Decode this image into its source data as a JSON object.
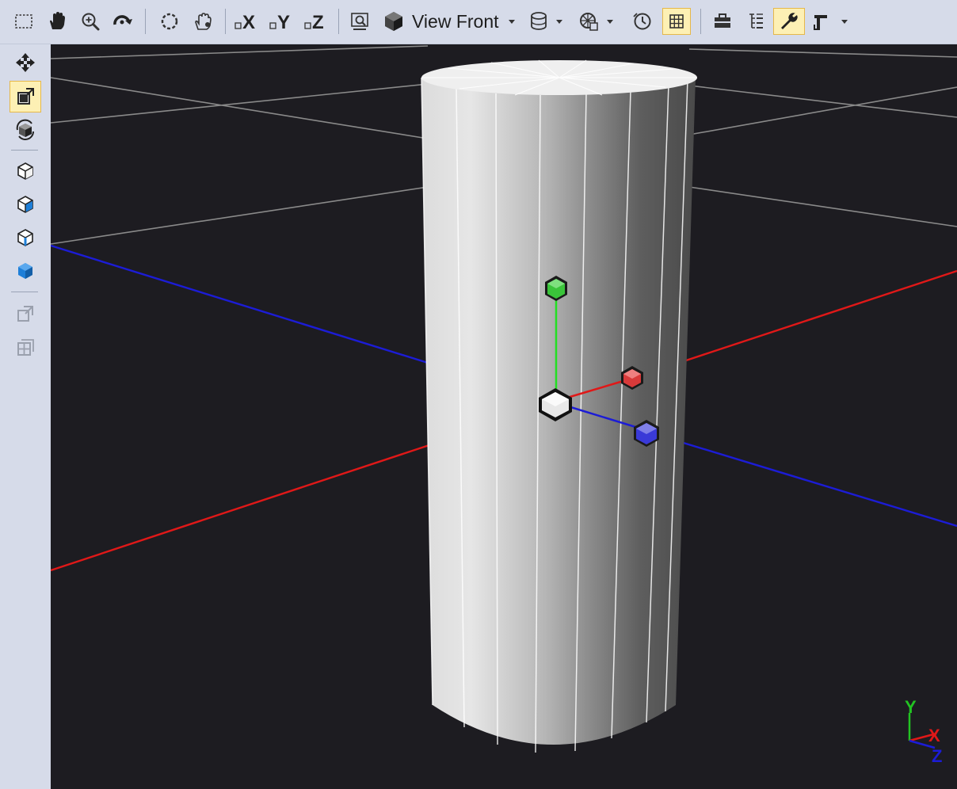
{
  "toolbar": {
    "items": [
      {
        "icon": "select-rect-icon"
      },
      {
        "icon": "pan-hand-icon"
      },
      {
        "icon": "zoom-icon"
      },
      {
        "icon": "orbit-icon"
      },
      {
        "icon": "frame-all-icon"
      },
      {
        "icon": "frame-selection-icon"
      },
      {
        "icon": "axis-x-icon",
        "label": "X"
      },
      {
        "icon": "axis-y-icon",
        "label": "Y"
      },
      {
        "icon": "axis-z-icon",
        "label": "Z"
      },
      {
        "icon": "zoom-fit-icon"
      },
      {
        "icon": "view-cube-icon"
      },
      {
        "icon": "shading-mode-icon"
      },
      {
        "icon": "lighting-icon"
      },
      {
        "icon": "animation-clock-icon"
      },
      {
        "icon": "grid-toggle-icon"
      },
      {
        "icon": "toolbox-icon"
      },
      {
        "icon": "document-outline-icon"
      },
      {
        "icon": "properties-wrench-icon"
      },
      {
        "icon": "more-options-icon"
      }
    ],
    "view_label": "View Front"
  },
  "sidebar": {
    "items": [
      {
        "icon": "move-tool-icon"
      },
      {
        "icon": "scale-tool-icon"
      },
      {
        "icon": "rotate-tool-icon"
      },
      {
        "icon": "select-object-icon"
      },
      {
        "icon": "select-face-icon"
      },
      {
        "icon": "select-edge-icon"
      },
      {
        "icon": "select-vertex-icon"
      },
      {
        "icon": "extrude-icon"
      },
      {
        "icon": "subdivide-icon"
      }
    ]
  },
  "viewport": {
    "background": "#1d1c21",
    "object": "cylinder",
    "axis_colors": {
      "x": "#e01818",
      "y": "#22c322",
      "z": "#1c1cd6"
    },
    "gizmo_colors": {
      "center": "#e8e8e8",
      "x": "#d83a3a",
      "y": "#3ac43a",
      "z": "#3a3ad8"
    },
    "orientation_labels": {
      "y": "Y",
      "x": "X",
      "z": "Z"
    }
  }
}
